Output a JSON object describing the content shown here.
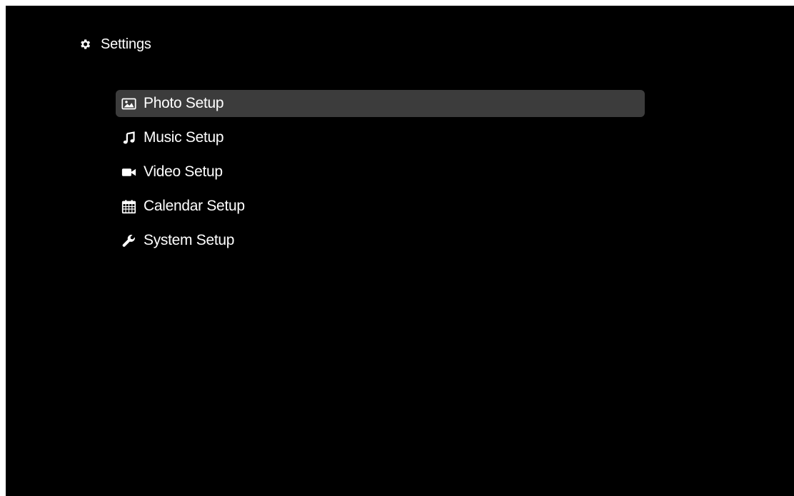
{
  "header": {
    "title": "Settings",
    "icon": "gear-icon"
  },
  "menu": {
    "selected_index": 0,
    "items": [
      {
        "label": "Photo Setup",
        "icon": "photo-icon"
      },
      {
        "label": "Music Setup",
        "icon": "music-note-icon"
      },
      {
        "label": "Video Setup",
        "icon": "video-camera-icon"
      },
      {
        "label": "Calendar Setup",
        "icon": "calendar-icon"
      },
      {
        "label": "System Setup",
        "icon": "wrench-icon"
      }
    ]
  },
  "colors": {
    "background": "#000000",
    "text": "#ffffff",
    "highlight": "#3c3c3c"
  }
}
